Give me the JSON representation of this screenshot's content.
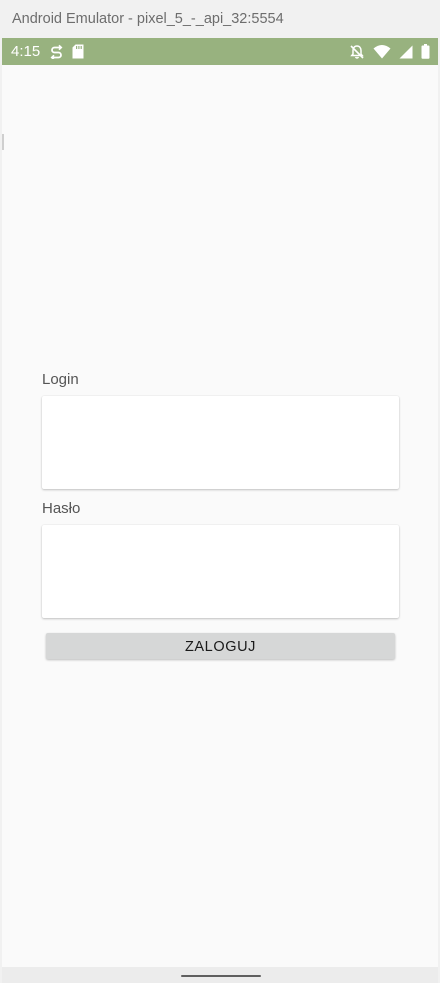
{
  "window": {
    "title": "Android Emulator - pixel_5_-_api_32:5554"
  },
  "status_bar": {
    "time": "4:15",
    "color": "#98b27f",
    "left_icons": [
      "sync-icon",
      "sd-card-icon"
    ],
    "right_icons": [
      "notifications-off-icon",
      "wifi-icon",
      "cellular-signal-icon",
      "battery-icon"
    ]
  },
  "form": {
    "login_label": "Login",
    "login_value": "",
    "password_label": "Hasło",
    "password_value": "",
    "submit_label": "ZALOGUJ"
  }
}
